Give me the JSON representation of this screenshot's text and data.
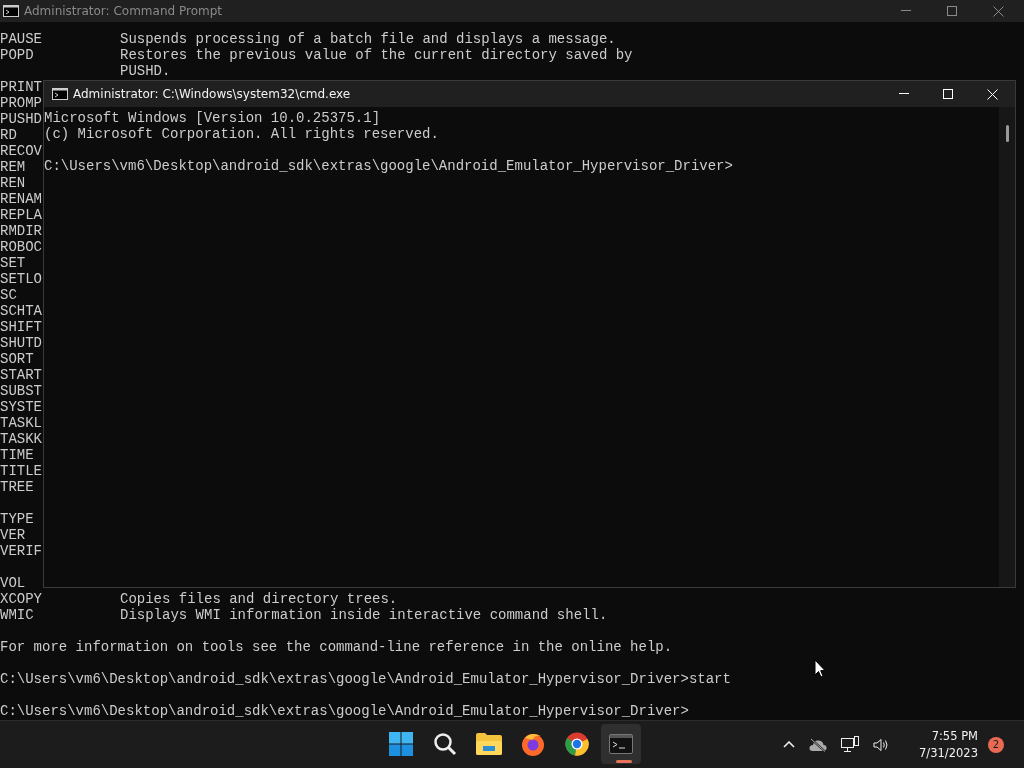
{
  "back_window": {
    "title": "Administrator:  Command Prompt",
    "lines": [
      {
        "kind": "entry",
        "command": "PAUSE",
        "description": "Suspends processing of a batch file and displays a message."
      },
      {
        "kind": "entry",
        "command": "POPD",
        "description": "Restores the previous value of the current directory saved by"
      },
      {
        "kind": "entry",
        "description": "PUSHD."
      },
      {
        "kind": "entry",
        "command": "PRINT"
      },
      {
        "kind": "entry",
        "command": "PROMP"
      },
      {
        "kind": "entry",
        "command": "PUSHD"
      },
      {
        "kind": "entry",
        "command": "RD"
      },
      {
        "kind": "entry",
        "command": "RECOV"
      },
      {
        "kind": "entry",
        "command": "REM"
      },
      {
        "kind": "entry",
        "command": "REN"
      },
      {
        "kind": "entry",
        "command": "RENAM"
      },
      {
        "kind": "entry",
        "command": "REPLA"
      },
      {
        "kind": "entry",
        "command": "RMDIR"
      },
      {
        "kind": "entry",
        "command": "ROBOC"
      },
      {
        "kind": "entry",
        "command": "SET"
      },
      {
        "kind": "entry",
        "command": "SETLO"
      },
      {
        "kind": "entry",
        "command": "SC"
      },
      {
        "kind": "entry",
        "command": "SCHTA"
      },
      {
        "kind": "entry",
        "command": "SHIFT"
      },
      {
        "kind": "entry",
        "command": "SHUTD"
      },
      {
        "kind": "entry",
        "command": "SORT"
      },
      {
        "kind": "entry",
        "command": "START"
      },
      {
        "kind": "entry",
        "command": "SUBST"
      },
      {
        "kind": "entry",
        "command": "SYSTE"
      },
      {
        "kind": "entry",
        "command": "TASKL"
      },
      {
        "kind": "entry",
        "command": "TASKK"
      },
      {
        "kind": "entry",
        "command": "TIME"
      },
      {
        "kind": "entry",
        "command": "TITLE"
      },
      {
        "kind": "entry",
        "command": "TREE"
      },
      {
        "kind": "blank"
      },
      {
        "kind": "entry",
        "command": "TYPE"
      },
      {
        "kind": "entry",
        "command": "VER"
      },
      {
        "kind": "entry",
        "command": "VERIF"
      },
      {
        "kind": "blank"
      },
      {
        "kind": "entry",
        "command": "VOL"
      },
      {
        "kind": "entry",
        "command": "XCOPY",
        "description": "Copies files and directory trees."
      },
      {
        "kind": "entry",
        "command": "WMIC",
        "description": "Displays WMI information inside interactive command shell."
      },
      {
        "kind": "blank"
      },
      {
        "kind": "text",
        "text": "For more information on tools see the command-line reference in the online help."
      },
      {
        "kind": "blank"
      },
      {
        "kind": "text",
        "text": "C:\\Users\\vm6\\Desktop\\android_sdk\\extras\\google\\Android_Emulator_Hypervisor_Driver>start"
      },
      {
        "kind": "blank"
      },
      {
        "kind": "text",
        "text": "C:\\Users\\vm6\\Desktop\\android_sdk\\extras\\google\\Android_Emulator_Hypervisor_Driver>"
      }
    ]
  },
  "front_window": {
    "title": "Administrator: C:\\Windows\\system32\\cmd.exe",
    "lines": [
      {
        "kind": "text",
        "text": "Microsoft Windows [Version 10.0.25375.1]"
      },
      {
        "kind": "text",
        "text": "(c) Microsoft Corporation. All rights reserved."
      },
      {
        "kind": "blank"
      },
      {
        "kind": "text",
        "text": "C:\\Users\\vm6\\Desktop\\android_sdk\\extras\\google\\Android_Emulator_Hypervisor_Driver>"
      }
    ]
  },
  "taskbar": {
    "apps": [
      {
        "kind": "start",
        "selected": false
      },
      {
        "kind": "search",
        "selected": false
      },
      {
        "kind": "files",
        "selected": false
      },
      {
        "kind": "firefox",
        "selected": false
      },
      {
        "kind": "chrome",
        "selected": false
      },
      {
        "kind": "terminal",
        "selected": true
      }
    ],
    "time": "7:55 PM",
    "date": "7/31/2023",
    "notifications": "2"
  }
}
